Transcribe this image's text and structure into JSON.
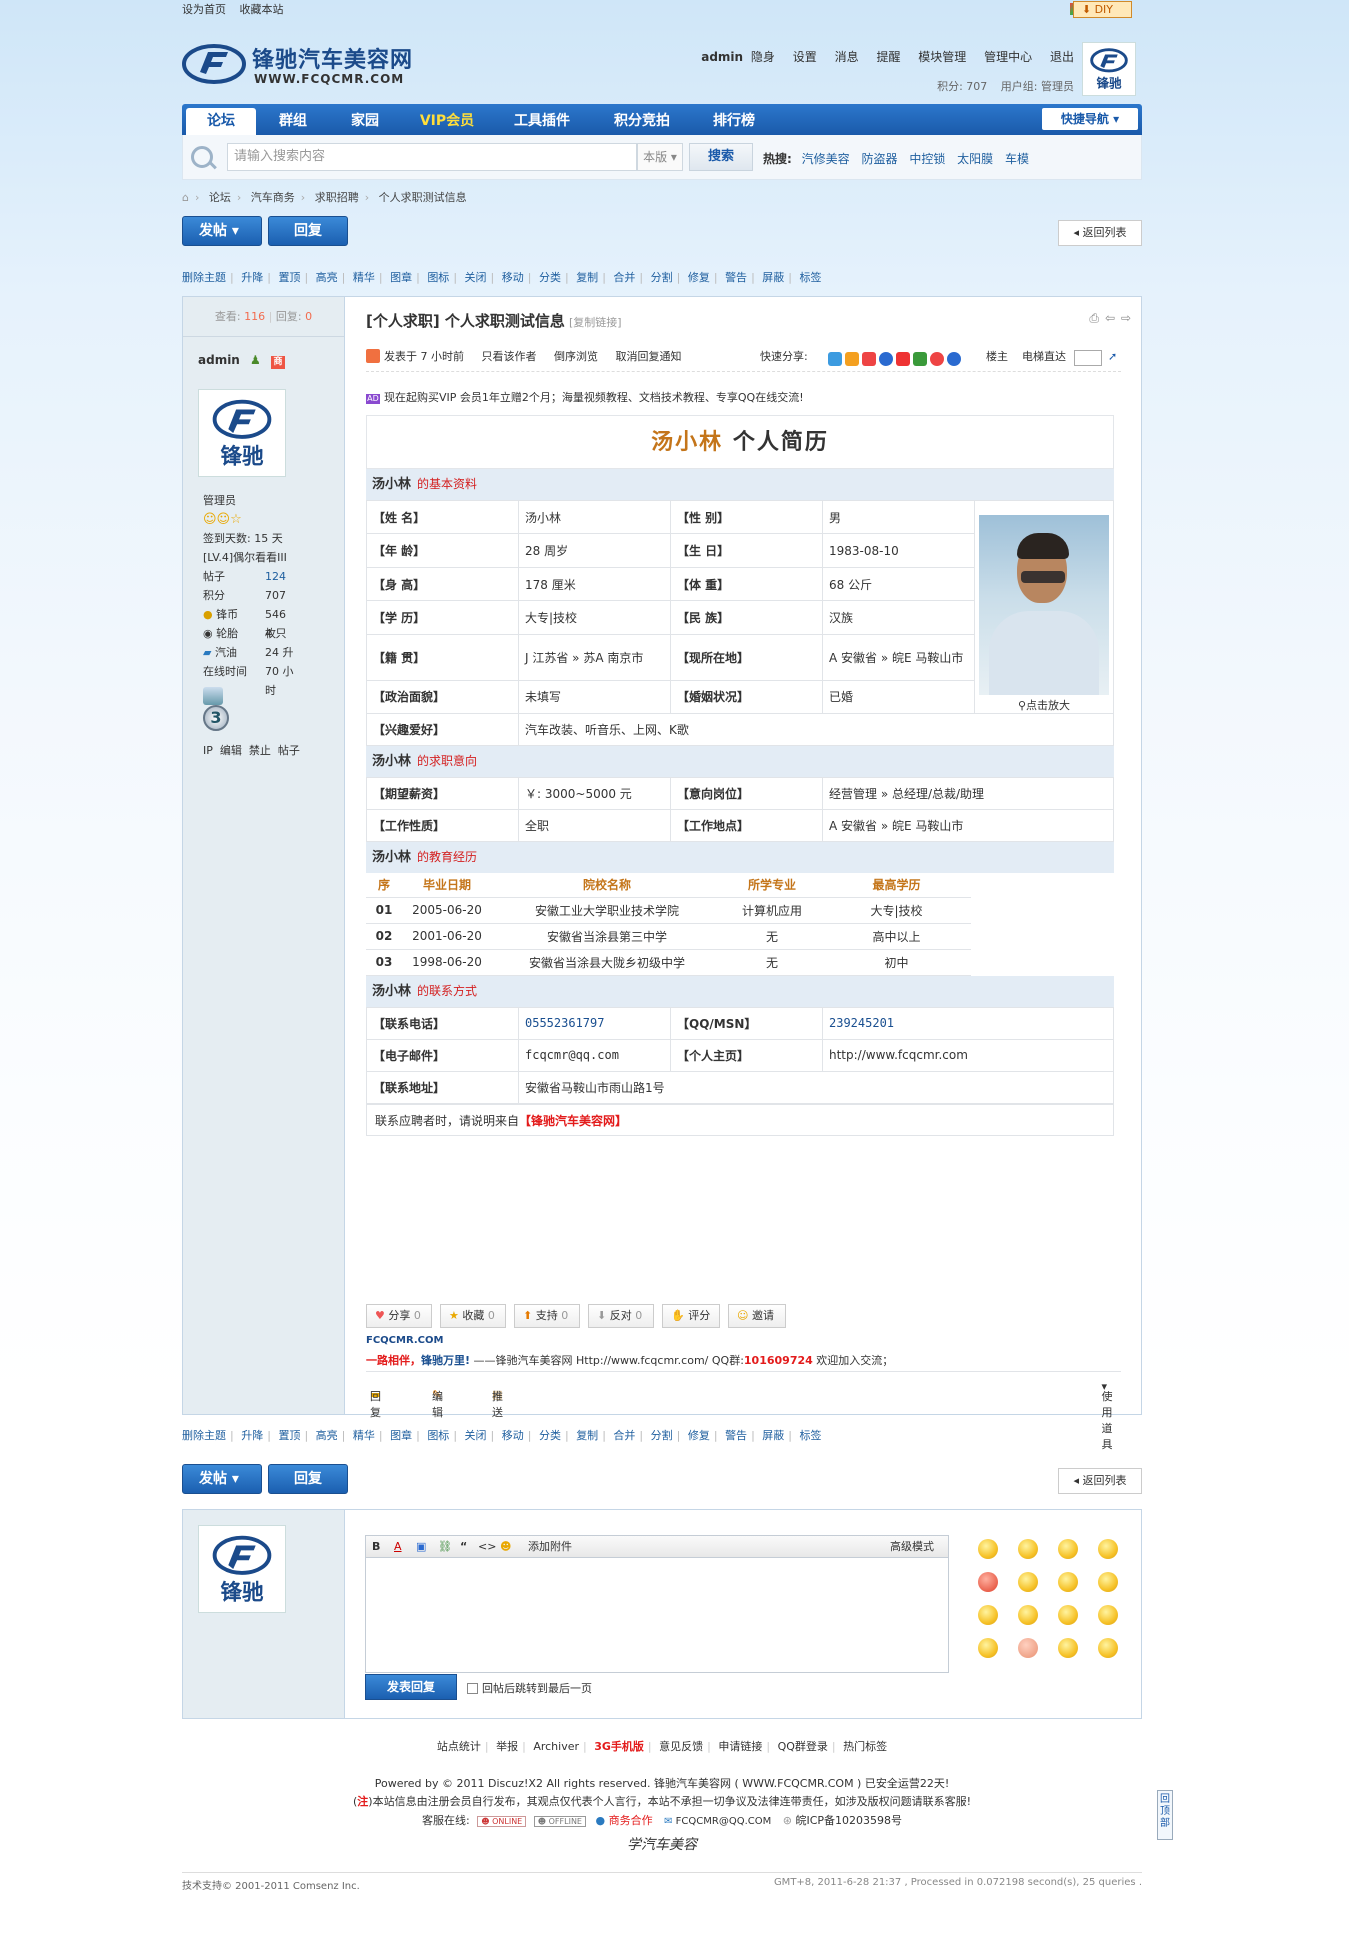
{
  "top": {
    "links": [
      "设为首页",
      "收藏本站"
    ],
    "diy": "DIY"
  },
  "header": {
    "logo_title": "锋驰汽车美容网",
    "logo_url": "WWW.FCQCMR.COM",
    "user": "admin",
    "hide": "隐身",
    "menu": [
      "设置",
      "消息",
      "提醒",
      "模块管理",
      "管理中心",
      "退出"
    ],
    "credits": "积分: 707",
    "group": "用户组: 管理员"
  },
  "nav": {
    "tabs": [
      "论坛",
      "群组",
      "家园",
      "VIP会员",
      "工具插件",
      "积分竞拍",
      "排行榜"
    ],
    "quick": "快捷导航"
  },
  "search": {
    "placeholder": "请输入搜索内容",
    "scope": "本版",
    "button": "搜索",
    "hot_label": "热搜:",
    "hot": [
      "汽修美容",
      "防盗器",
      "中控锁",
      "太阳膜",
      "车模"
    ]
  },
  "breadcrumb": [
    "论坛",
    "汽车商务",
    "求职招聘",
    "个人求职测试信息"
  ],
  "actions": {
    "post": "发帖",
    "reply": "回复",
    "back": "返回列表"
  },
  "mod": [
    "删除主题",
    "升降",
    "置顶",
    "高亮",
    "精华",
    "图章",
    "图标",
    "关闭",
    "移动",
    "分类",
    "复制",
    "合并",
    "分割",
    "修复",
    "警告",
    "屏蔽",
    "标签"
  ],
  "post": {
    "views_label": "查看:",
    "views": "116",
    "replies_label": "回复:",
    "replies": "0",
    "author": "admin",
    "title": "[个人求职] 个人求职测试信息",
    "copylink": "[复制链接]",
    "posted": "发表于 7 小时前",
    "only_author": "只看该作者",
    "reverse": "倒序浏览",
    "cancel_notify": "取消回复通知",
    "share_label": "快速分享:",
    "floor": "楼主",
    "goto": "电梯直达",
    "ad": "现在起购买VIP 会员1年立赠2个月；海量视频教程、文档技术教程、专享QQ在线交流!"
  },
  "profile": {
    "group": "管理员",
    "signin_days": "签到天数: 15 天",
    "level": "[LV.4]偶尔看看III",
    "stats": [
      {
        "label": "帖子",
        "value": "124"
      },
      {
        "label": "积分",
        "value": "707"
      },
      {
        "label": "锋币",
        "value": "546 枚"
      },
      {
        "label": "轮胎",
        "value": "4 只"
      },
      {
        "label": "汽油",
        "value": "24 升"
      },
      {
        "label": "在线时间",
        "value": "70 小时"
      }
    ],
    "tools": "IP  编辑  禁止  帖子"
  },
  "resume": {
    "name": "汤小林",
    "title_suffix": "个人简历",
    "sec_basic": "的基本资料",
    "sec_job": "的求职意向",
    "sec_edu": "的教育经历",
    "sec_contact": "的联系方式",
    "photo_caption": "点击放大",
    "basic": [
      [
        "【姓 名】",
        "汤小林",
        "【性 别】",
        "男"
      ],
      [
        "【年 龄】",
        "28 周岁",
        "【生 日】",
        "1983-08-10"
      ],
      [
        "【身 高】",
        "178 厘米",
        "【体 重】",
        "68 公斤"
      ],
      [
        "【学 历】",
        "大专|技校",
        "【民 族】",
        "汉族"
      ],
      [
        "【籍 贯】",
        "J 江苏省 » 苏A 南京市",
        "【现所在地】",
        "A 安徽省 » 皖E 马鞍山市"
      ],
      [
        "【政治面貌】",
        "未填写",
        "【婚姻状况】",
        "已婚"
      ]
    ],
    "hobby_label": "【兴趣爱好】",
    "hobby": "汽车改装、听音乐、上网、K歌",
    "job": [
      [
        "【期望薪资】",
        "￥: 3000~5000 元",
        "【意向岗位】",
        "经营管理 » 总经理/总裁/助理"
      ],
      [
        "【工作性质】",
        "全职",
        "【工作地点】",
        "A 安徽省 » 皖E 马鞍山市"
      ]
    ],
    "edu_headers": [
      "序",
      "毕业日期",
      "院校名称",
      "所学专业",
      "最高学历"
    ],
    "edu": [
      [
        "01",
        "2005-06-20",
        "安徽工业大学职业技术学院",
        "计算机应用",
        "大专|技校"
      ],
      [
        "02",
        "2001-06-20",
        "安徽省当涂县第三中学",
        "无",
        "高中以上"
      ],
      [
        "03",
        "1998-06-20",
        "安徽省当涂县大陇乡初级中学",
        "无",
        "初中"
      ]
    ],
    "contact": [
      [
        "【联系电话】",
        "05552361797",
        "【QQ/MSN】",
        "239245201"
      ],
      [
        "【电子邮件】",
        "fcqcmr@qq.com",
        "【个人主页】",
        "http://www.fcqcmr.com"
      ]
    ],
    "addr_label": "【联系地址】",
    "addr": "安徽省马鞍山市雨山路1号",
    "note": "联系应聘者时，请说明来自",
    "note_src": "【锋驰汽车美容网】"
  },
  "rate_buttons": [
    {
      "label": "分享",
      "count": "0"
    },
    {
      "label": "收藏",
      "count": "0"
    },
    {
      "label": "支持",
      "count": "0"
    },
    {
      "label": "反对",
      "count": "0"
    },
    {
      "label": "评分",
      "count": ""
    },
    {
      "label": "邀请",
      "count": ""
    }
  ],
  "signature": {
    "brand": "FCQCMR.COM",
    "slogan1": "一路相伴，",
    "slogan2": "锋驰万里!",
    "text": "——锋驰汽车美容网 Http://www.fcqcmr.com/ QQ群:",
    "qq": "101609724",
    "tail": "欢迎加入交流；"
  },
  "post_foot": {
    "reply": "回复",
    "edit": "编辑",
    "push": "推送",
    "tools": "使用道具"
  },
  "reply_box": {
    "attach": "添加附件",
    "advanced": "高级模式",
    "submit": "发表回复",
    "checkbox": "回帖后跳转到最后一页"
  },
  "footer": {
    "links": [
      "站点统计",
      "举报",
      "Archiver",
      "3G手机版",
      "意见反馈",
      "申请链接",
      "QQ群登录",
      "热门标签"
    ],
    "powered": "Powered by © 2011 Discuz!X2 All rights reserved.   锋驰汽车美容网 ( WWW.FCQCMR.COM ) 已安全运营22天!",
    "disclaimer_mark": "注",
    "disclaimer": "本站信息由注册会员自行发布，其观点仅代表个人言行，本站不承担一切争议及法律连带责任，如涉及版权问题请联系客服!",
    "service_label": "客服在线:",
    "online": "ONLINE",
    "offline": "OFFLINE",
    "biz": "商务合作",
    "email": "FCQCMR@QQ.COM",
    "icp": "皖ICP备10203598号",
    "sign": "学汽车美容",
    "tech": "技术支持© 2001-2011 Comsenz Inc.",
    "time": "GMT+8, 2011-6-28 21:37 , Processed in 0.072198 second(s), 25 queries .",
    "totop": "回顶部"
  }
}
